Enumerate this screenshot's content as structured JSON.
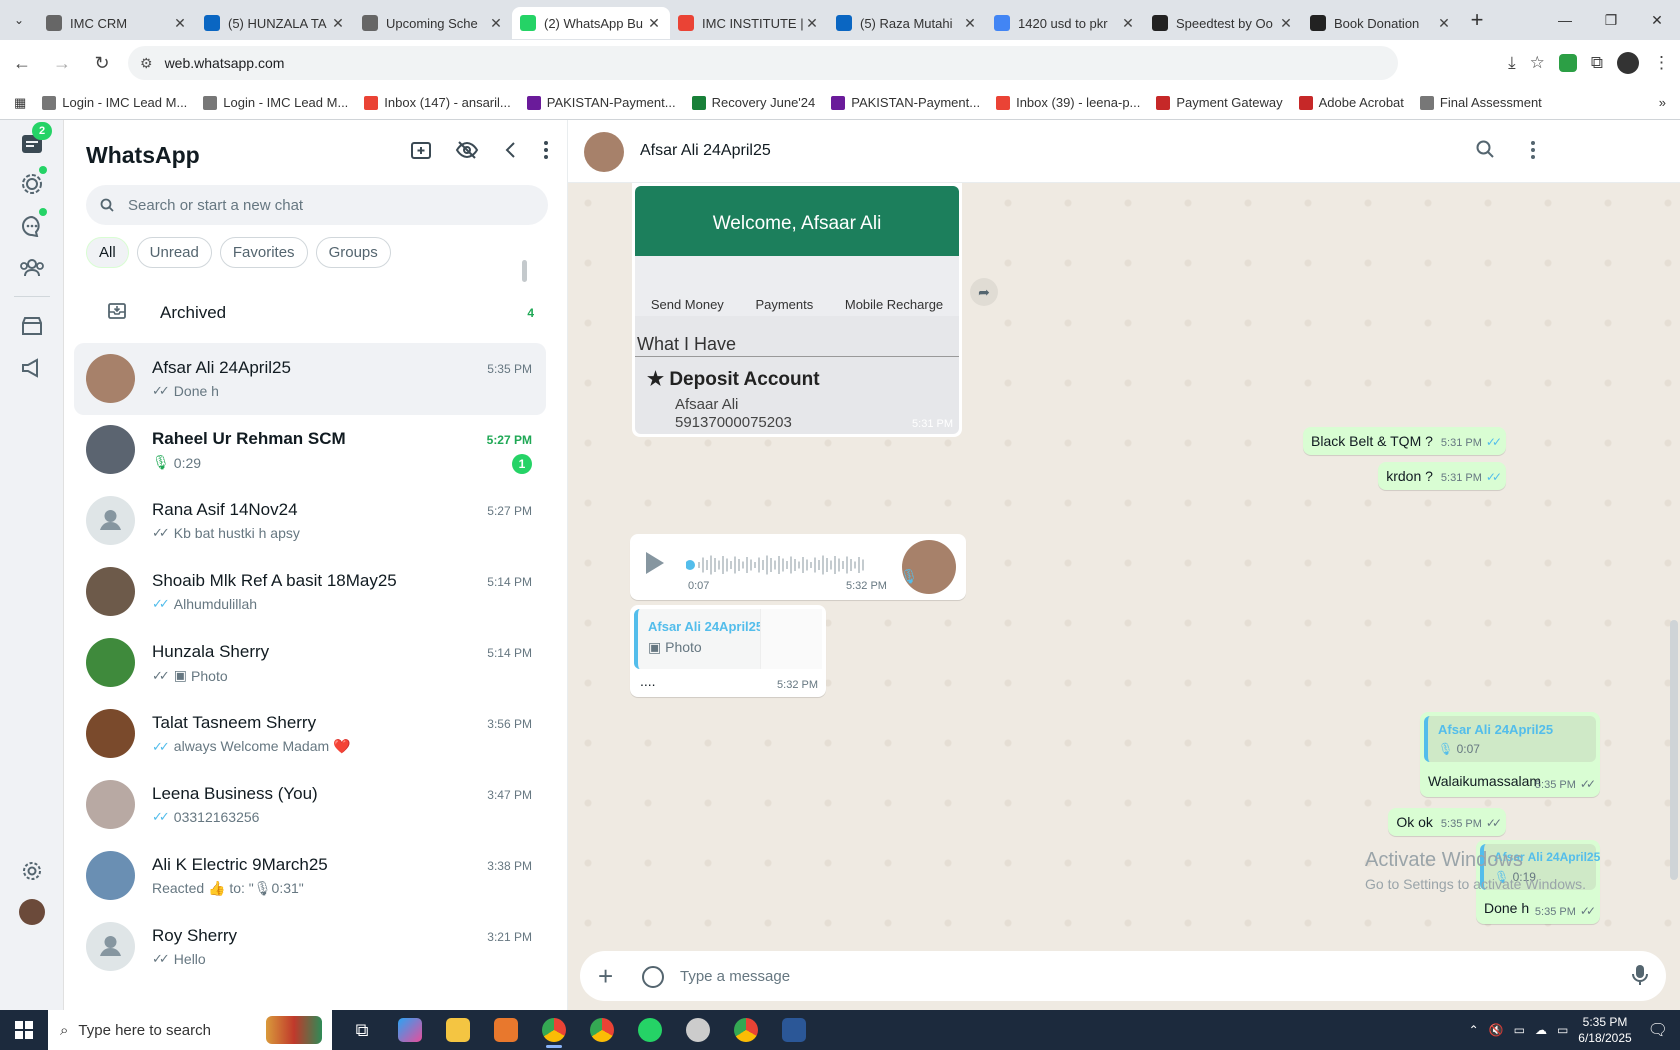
{
  "browser": {
    "tabs": [
      {
        "title": "IMC CRM",
        "color": "#666",
        "active": false
      },
      {
        "title": "(5) HUNZALA TA",
        "color": "#0a66c2",
        "active": false
      },
      {
        "title": "Upcoming Sche",
        "color": "#666",
        "active": false
      },
      {
        "title": "(2) WhatsApp Bu",
        "color": "#25d366",
        "active": true
      },
      {
        "title": "IMC INSTITUTE |",
        "color": "#ea4335",
        "active": false
      },
      {
        "title": "(5) Raza Mutahi",
        "color": "#0a66c2",
        "active": false
      },
      {
        "title": "1420 usd to pkr",
        "color": "#4285f4",
        "active": false
      },
      {
        "title": "Speedtest by Oo",
        "color": "#222",
        "active": false
      },
      {
        "title": "Book Donation",
        "color": "#222",
        "active": false
      }
    ],
    "url": "web.whatsapp.com",
    "bookmarks": [
      {
        "label": "Login - IMC Lead M...",
        "color": "#777"
      },
      {
        "label": "Login - IMC Lead M...",
        "color": "#777"
      },
      {
        "label": "Inbox (147) - ansaril...",
        "color": "#ea4335"
      },
      {
        "label": "PAKISTAN-Payment...",
        "color": "#6a1b9a"
      },
      {
        "label": "Recovery June'24",
        "color": "#188038"
      },
      {
        "label": "PAKISTAN-Payment...",
        "color": "#6a1b9a"
      },
      {
        "label": "Inbox (39) - leena-p...",
        "color": "#ea4335"
      },
      {
        "label": "Payment Gateway",
        "color": "#c62828"
      },
      {
        "label": "Adobe Acrobat",
        "color": "#c62828"
      },
      {
        "label": "Final Assessment",
        "color": "#777"
      }
    ]
  },
  "whatsapp": {
    "rail_badge": "2",
    "title": "WhatsApp",
    "search_placeholder": "Search or start a new chat",
    "filters": [
      "All",
      "Unread",
      "Favorites",
      "Groups"
    ],
    "archived_label": "Archived",
    "archived_count": "4",
    "chats": [
      {
        "name": "Afsar Ali 24April25",
        "time": "5:35 PM",
        "preview": "Done h",
        "tick": "gray",
        "selected": true,
        "bold": false,
        "unread": "",
        "avatar": "#a7816a"
      },
      {
        "name": "Raheel Ur Rehman SCM",
        "time": "5:27 PM",
        "preview": "0:29",
        "tick": "mic",
        "selected": false,
        "bold": true,
        "unread": "1",
        "avatar": "#5b6470"
      },
      {
        "name": "Rana Asif 14Nov24",
        "time": "5:27 PM",
        "preview": "Kb bat hustki h apsy",
        "tick": "gray",
        "selected": false,
        "bold": false,
        "unread": "",
        "avatar": "default"
      },
      {
        "name": "Shoaib Mlk Ref A basit 18May25",
        "time": "5:14 PM",
        "preview": "Alhumdulillah",
        "tick": "blue",
        "selected": false,
        "bold": false,
        "unread": "",
        "avatar": "#6d5a4a"
      },
      {
        "name": "Hunzala Sherry",
        "time": "5:14 PM",
        "preview": "Photo",
        "tick": "gray-photo",
        "selected": false,
        "bold": false,
        "unread": "",
        "avatar": "#3f8a3c"
      },
      {
        "name": "Talat Tasneem Sherry",
        "time": "3:56 PM",
        "preview": "always Welcome Madam ❤️",
        "tick": "blue",
        "selected": false,
        "bold": false,
        "unread": "",
        "avatar": "#7a4a2c"
      },
      {
        "name": "Leena Business (You)",
        "time": "3:47 PM",
        "preview": "03312163256",
        "tick": "blue",
        "selected": false,
        "bold": false,
        "unread": "",
        "avatar": "#b8a9a3"
      },
      {
        "name": "Ali K Electric 9March25",
        "time": "3:38 PM",
        "preview": "Reacted 👍 to: \"🎙0:31\"",
        "tick": "none",
        "selected": false,
        "bold": false,
        "unread": "",
        "avatar": "#6a8fb3"
      },
      {
        "name": "Roy Sherry",
        "time": "3:21 PM",
        "preview": "Hello",
        "tick": "gray",
        "selected": false,
        "bold": false,
        "unread": "",
        "avatar": "default"
      }
    ],
    "conversation": {
      "contact": "Afsar Ali 24April25",
      "image_msg": {
        "welcome": "Welcome, Afsaar Ali",
        "icons": [
          "Send Money",
          "Payments",
          "Mobile Recharge"
        ],
        "section": "What I Have",
        "account_type": "Deposit Account",
        "holder": "Afsaar Ali",
        "number": "59137000075203",
        "time": "5:31 PM"
      },
      "out1": {
        "text": "Black Belt & TQM ?",
        "time": "5:31 PM"
      },
      "out2": {
        "text": "krdon ?",
        "time": "5:31 PM"
      },
      "voice": {
        "duration": "0:07",
        "time": "5:32 PM"
      },
      "quote_in": {
        "name": "Afsar Ali 24April25",
        "sub": "Photo",
        "text": "....",
        "time": "5:32 PM"
      },
      "quote_out1": {
        "name": "Afsar Ali 24April25",
        "dur": "0:07",
        "text": "Walaikumassalam",
        "time": "5:35 PM"
      },
      "out3": {
        "text": "Ok ok",
        "time": "5:35 PM"
      },
      "quote_out2": {
        "name": "Afsar Ali 24April25",
        "dur": "0:19",
        "text": "Done h",
        "time": "5:35 PM"
      }
    },
    "composer_placeholder": "Type a message",
    "watermark_title": "Activate Windows",
    "watermark_sub": "Go to Settings to activate Windows."
  },
  "taskbar": {
    "search_placeholder": "Type here to search",
    "time": "5:35 PM",
    "date": "6/18/2025"
  }
}
